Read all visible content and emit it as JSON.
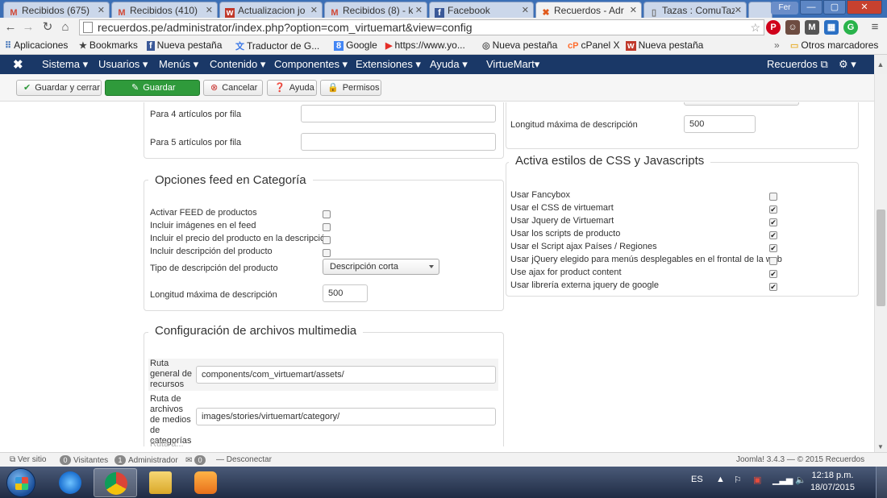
{
  "browser": {
    "tabs": [
      {
        "label": "Recibidos (675)",
        "icon": "gmail-icon",
        "active": false
      },
      {
        "label": "Recibidos (410)",
        "icon": "gmail-icon",
        "active": false
      },
      {
        "label": "Actualizacion jo",
        "icon": "w-icon",
        "active": false
      },
      {
        "label": "Recibidos (8) - k",
        "icon": "gmail-icon",
        "active": false
      },
      {
        "label": "Facebook",
        "icon": "facebook-icon",
        "active": false
      },
      {
        "label": "Recuerdos - Adr",
        "icon": "joomla-icon",
        "active": true
      },
      {
        "label": "Tazas : ComuTaz",
        "icon": "page-icon",
        "active": false
      }
    ],
    "user_badge": "Fer",
    "url": "recuerdos.pe/administrator/index.php?option=com_virtuemart&view=config",
    "bookmarks": [
      {
        "label": "Aplicaciones",
        "icon": "apps-icon"
      },
      {
        "label": "Bookmarks",
        "icon": "star-icon"
      },
      {
        "label": "Nueva pestaña",
        "icon": "facebook-icon"
      },
      {
        "label": "Traductor de G...",
        "icon": "translate-icon"
      },
      {
        "label": "Google",
        "icon": "google-icon"
      },
      {
        "label": "https://www.yo...",
        "icon": "youtube-icon"
      },
      {
        "label": "Nueva pestaña",
        "icon": "globe-icon"
      },
      {
        "label": "cPanel X",
        "icon": "cpanel-icon"
      },
      {
        "label": "Nueva pestaña",
        "icon": "w-icon"
      }
    ],
    "other_bookmarks": "Otros marcadores"
  },
  "joomla_nav": {
    "menus": [
      "Sistema ▾",
      "Usuarios ▾",
      "Menús ▾",
      "Contenido ▾",
      "Componentes ▾",
      "Extensiones ▾",
      "Ayuda ▾",
      "VirtueMart▾"
    ],
    "site": "Recuerdos ⧉",
    "settings": "⚙ ▾"
  },
  "toolbar": {
    "save_close": "Guardar y cerrar",
    "save": "Guardar",
    "cancel": "Cancelar",
    "help": "Ayuda",
    "permissions": "Permisos"
  },
  "left": {
    "per_row_4": "Para 4 artículos por fila",
    "per_row_5": "Para 5 artículos por fila",
    "feed": {
      "legend": "Opciones feed en Categoría",
      "activate": "Activar FEED de productos",
      "images": "Incluir imágenes en el feed",
      "price": "Incluir el precio del producto en la descripción",
      "description": "Incluir descripción del producto",
      "desc_type_label": "Tipo de descripción del producto",
      "desc_type_value": "Descripción corta",
      "max_len_label": "Longitud máxima de descripción",
      "max_len_value": "500"
    },
    "media": {
      "legend": "Configuración de archivos multimedia",
      "general_path_label": "Ruta general de recursos",
      "general_path_value": "components/com_virtuemart/assets/",
      "category_path_label": "Ruta de archivos de medios de categorías",
      "category_path_value": "images/stories/virtuemart/category/",
      "next_label_partial": "Ruta a..."
    }
  },
  "right": {
    "max_len_label": "Longitud máxima de descripción",
    "max_len_value": "500",
    "css": {
      "legend": "Activa estilos de CSS y Javascripts",
      "items": [
        {
          "label": "Usar Fancybox",
          "checked": false
        },
        {
          "label": "Usar el CSS de virtuemart",
          "checked": true
        },
        {
          "label": "Usar Jquery de Virtuemart",
          "checked": true
        },
        {
          "label": "Usar los scripts de producto",
          "checked": true
        },
        {
          "label": "Usar el Script ajax Países / Regiones",
          "checked": true
        },
        {
          "label": "Usar jQuery elegido para menús desplegables en el frontal de la web",
          "checked": false
        },
        {
          "label": "Use ajax for product content",
          "checked": true
        },
        {
          "label": "Usar librería externa jquery de google",
          "checked": true
        }
      ]
    }
  },
  "status": {
    "view_site": "Ver sitio",
    "visitors_count": "0",
    "visitors": "Visitantes",
    "admins_count": "1",
    "admins": "Administrador",
    "messages_count": "0",
    "logout": "Desconectar",
    "version": "Joomla! 3.4.3 — © 2015 Recuerdos"
  },
  "taskbar": {
    "lang": "ES",
    "time": "12:18 p.m.",
    "date": "18/07/2015"
  },
  "colors": {
    "joomla_nav": "#1a3867",
    "save_green": "#2f9a3b",
    "tab_strip": "#3b6fb6"
  }
}
